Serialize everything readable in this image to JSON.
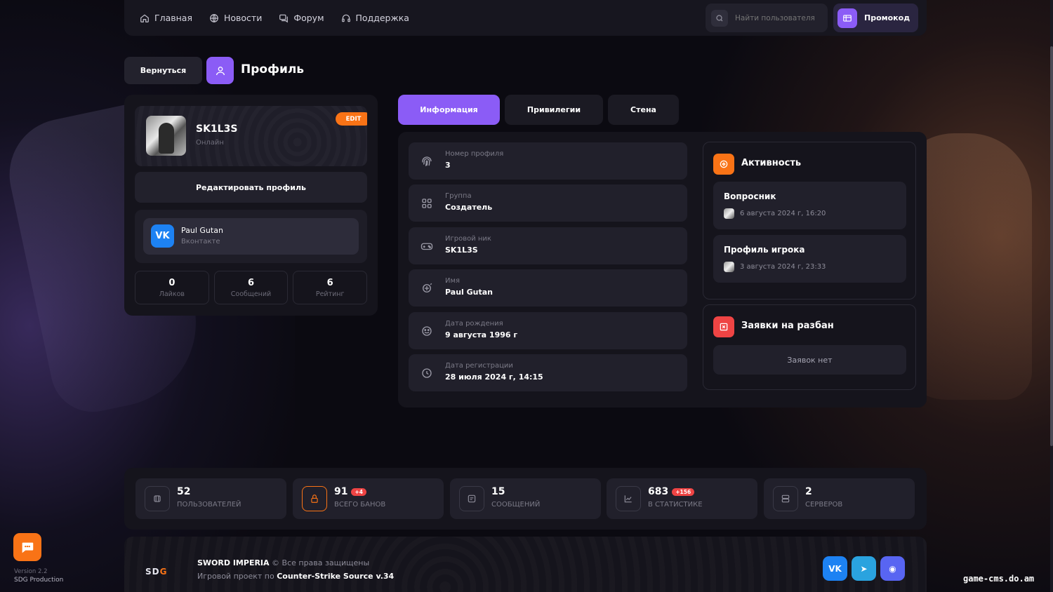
{
  "nav": {
    "items": [
      {
        "label": "Главная",
        "icon": "home-icon"
      },
      {
        "label": "Новости",
        "icon": "globe-icon"
      },
      {
        "label": "Форум",
        "icon": "chat-icon"
      },
      {
        "label": "Поддержка",
        "icon": "headset-icon"
      }
    ],
    "search_placeholder": "Найти пользователя",
    "promo_label": "Промокод"
  },
  "header": {
    "back_label": "Вернуться",
    "title": "Профиль"
  },
  "profile": {
    "name": "SK1L3S",
    "status": "Онлайн",
    "edit_badge": "EDIT",
    "edit_button": "Редактировать профиль",
    "social": {
      "name": "Paul Gutan",
      "network": "Вконтакте",
      "glyph": "VK"
    },
    "stats": [
      {
        "value": "0",
        "label": "Лайков"
      },
      {
        "value": "6",
        "label": "Сообщений"
      },
      {
        "value": "6",
        "label": "Рейтинг"
      }
    ]
  },
  "tabs": [
    {
      "label": "Информация",
      "active": true
    },
    {
      "label": "Привилегии",
      "active": false
    },
    {
      "label": "Стена",
      "active": false
    }
  ],
  "info": [
    {
      "label": "Номер профиля",
      "value": "3",
      "icon": "fingerprint-icon"
    },
    {
      "label": "Группа",
      "value": "Создатель",
      "icon": "grid-icon"
    },
    {
      "label": "Игровой ник",
      "value": "SK1L3S",
      "icon": "gamepad-icon"
    },
    {
      "label": "Имя",
      "value": "Paul Gutan",
      "icon": "id-icon"
    },
    {
      "label": "Дата рождения",
      "value": "9 августа 1996 г",
      "icon": "cake-icon"
    },
    {
      "label": "Дата регистрации",
      "value": "28 июля 2024 г, 14:15",
      "icon": "clock-icon"
    }
  ],
  "activity": {
    "title": "Активность",
    "items": [
      {
        "title": "Вопросник",
        "date": "6 августа 2024 г, 16:20"
      },
      {
        "title": "Профиль игрока",
        "date": "3 августа 2024 г, 23:33"
      }
    ]
  },
  "unban": {
    "title": "Заявки на разбан",
    "empty": "Заявок нет"
  },
  "site_stats": [
    {
      "value": "52",
      "label": "ПОЛЬЗОВАТЕЛЕЙ",
      "badge": "",
      "icon": "users-icon"
    },
    {
      "value": "91",
      "label": "ВСЕГО БАНОВ",
      "badge": "+4",
      "icon": "lock-icon"
    },
    {
      "value": "15",
      "label": "СООБЩЕНИЙ",
      "badge": "",
      "icon": "message-icon"
    },
    {
      "value": "683",
      "label": "В СТАТИСТИКЕ",
      "badge": "+156",
      "icon": "chart-icon"
    },
    {
      "value": "2",
      "label": "СЕРВЕРОВ",
      "badge": "",
      "icon": "server-icon"
    }
  ],
  "footer": {
    "logo_a": "SD",
    "logo_b": "G",
    "brand": "SWORD IMPERIA",
    "copyright": " © Все права защищены",
    "project_prefix": "Игровой проект по ",
    "project": "Counter-Strike Source v.34",
    "socials": [
      {
        "glyph": "VK",
        "color": "#1d82f3"
      },
      {
        "glyph": "➤",
        "color": "#2aa3df"
      },
      {
        "glyph": "◉",
        "color": "#5865f2"
      }
    ]
  },
  "corner": {
    "version": "Version 2.2",
    "producer": "SDG Production"
  },
  "watermark": "game-cms.do.am",
  "colors": {
    "accent": "#8b5cf6",
    "orange": "#f97316",
    "red": "#ef4444",
    "vk": "#1d82f3"
  }
}
